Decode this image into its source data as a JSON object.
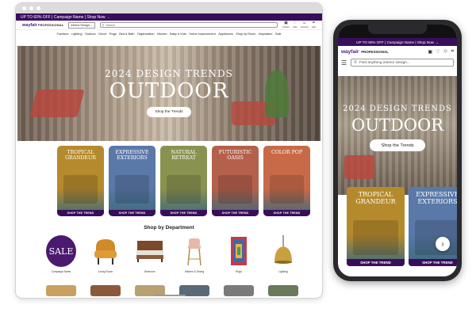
{
  "desktop": {
    "promo": "UP TO 60% OFF | Campaign Name | Shop Now →",
    "logo": "wayfair",
    "logo_pro": "PROFESSIONAL",
    "selector": "Interior Design",
    "search_placeholder": "Search",
    "icons": [
      {
        "name": "orders-icon",
        "glyph": "▣",
        "label": "Orders"
      },
      {
        "name": "lists-icon",
        "glyph": "♡",
        "label": "Lists"
      },
      {
        "name": "account-icon",
        "glyph": "☺",
        "label": "Account"
      },
      {
        "name": "cart-icon",
        "glyph": "⌗",
        "label": "Cart"
      }
    ],
    "categories": [
      "Furniture",
      "Lighting",
      "Outdoor",
      "Decor",
      "Rugs",
      "Bed & Bath",
      "Organization",
      "Kitchen",
      "Baby & Kids",
      "Home Improvement",
      "Appliances",
      "Shop by Room",
      "Inspiration",
      "Sale"
    ],
    "hero": {
      "subtitle": "2024 DESIGN TRENDS",
      "title": "OUTDOOR",
      "button": "Shop the Trends"
    },
    "trends": [
      {
        "title": "TROPICAL GRANDEUR",
        "cta": "SHOP THE TREND",
        "color": "#b58a2c"
      },
      {
        "title": "EXPRESSIVE EXTERIORS",
        "cta": "SHOP THE TREND",
        "color": "#5a78a8"
      },
      {
        "title": "NATURAL RETREAT",
        "cta": "SHOP THE TREND",
        "color": "#8a9250"
      },
      {
        "title": "FUTURISTIC OASIS",
        "cta": "SHOP THE TREND",
        "color": "#b4604a"
      },
      {
        "title": "COLOR POP",
        "cta": "SHOP THE TREND",
        "color": "#c86a48"
      }
    ],
    "shop_by_department": "Shop by Department",
    "departments": [
      {
        "label": "Campaign Name",
        "sale_text": "SALE"
      },
      {
        "label": "Living Room"
      },
      {
        "label": "Bedroom"
      },
      {
        "label": "Kitchen & Dining"
      },
      {
        "label": "Rugs"
      },
      {
        "label": "Lighting"
      }
    ]
  },
  "mobile": {
    "promo": "UP TO 60% OFF | Campaign Name | Shop Now →",
    "logo": "wayfair",
    "logo_pro": "PROFESSIONAL",
    "search_placeholder": "Find anything interior design...",
    "hero": {
      "subtitle": "2024 DESIGN TRENDS",
      "title": "OUTDOOR",
      "button": "Shop the Trends"
    },
    "trends": [
      {
        "title": "TROPICAL GRANDEUR",
        "cta": "SHOP THE TREND",
        "color": "#b58a2c"
      },
      {
        "title": "EXPRESSIVE EXTERIORS",
        "cta": "SHOP THE TREND",
        "color": "#5a78a8"
      }
    ]
  },
  "colors": {
    "brand_purple": "#3a0d5c",
    "sale_purple": "#4b1a6e"
  }
}
